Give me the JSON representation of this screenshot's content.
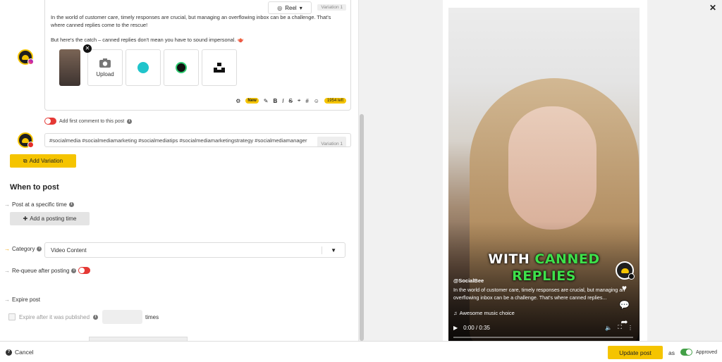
{
  "editor": {
    "format_select": "Reel",
    "variation_tag": "Variation 1",
    "post_text_p1": "In the world of customer care, timely responses are crucial, but managing an overflowing inbox can be a challenge. That's where canned replies come to the rescue!",
    "post_text_p2": "But here's the catch – canned replies don't mean you have to sound impersonal. 🫖",
    "upload_label": "Upload",
    "new_badge": "New",
    "chars_left": "1954 left",
    "toolbar_bold": "B",
    "toolbar_italic": "I",
    "toolbar_strike": "S",
    "toolbar_hash": "#"
  },
  "first_comment": {
    "label": "Add first comment to this post"
  },
  "hashtags": {
    "value": "#socialmedia #socialmediamarketing #socialmediatips #socialmediamarketingstrategy #socialmediamanager",
    "variation_tag": "Variation 1"
  },
  "add_variation_label": "Add Variation",
  "when_to_post": {
    "title": "When to post",
    "specific_time_label": "Post at a specific time",
    "add_time_label": "Add a posting time",
    "category_label": "Category",
    "category_value": "Video Content",
    "requeue_label": "Re-queue after posting",
    "expire_label": "Expire post",
    "expire_after_label": "Expire after it was published",
    "times_label": "times"
  },
  "preview": {
    "caption_line1_white": "WITH ",
    "caption_line1_green": "CANNED",
    "caption_line2_green": "REPLIES",
    "handle": "@SocialBee",
    "description": "In the world of customer care, timely responses are crucial, but managing an overflowing inbox can be a challenge. That's where canned replies...",
    "music": "Awesome music choice",
    "time": "0:00 / 0:35",
    "progress": 0
  },
  "footer": {
    "cancel_label": "Cancel",
    "update_label": "Update post",
    "as_label": "as",
    "approved_label": "Approved"
  },
  "colors": {
    "accent": "#f5c400",
    "toggle_off": "#e53935",
    "toggle_on": "#43a047",
    "caption_green": "#3ee04a"
  }
}
